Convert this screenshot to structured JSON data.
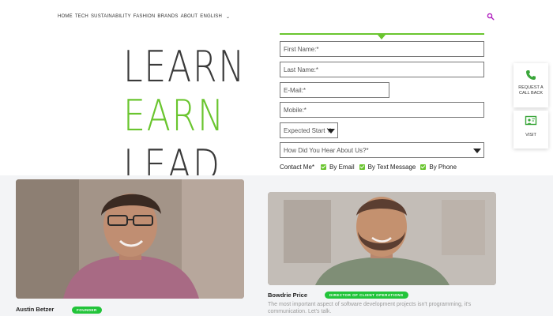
{
  "nav": {
    "items": [
      "HOME",
      "TECH",
      "SUSTAINABILITY",
      "FASHION",
      "BRANDS",
      "ABOUT",
      "ENGLISH"
    ],
    "search_icon": "search-icon",
    "accent": "#b01fbf"
  },
  "hero": {
    "line1": "LEARN",
    "line2": "EARN",
    "line3": "LEAD",
    "accent": "#6ac52f"
  },
  "form": {
    "first_name": "First Name:*",
    "last_name": "Last Name:*",
    "email": "E-Mail:*",
    "mobile": "Mobile:*",
    "expected_start": "Expected Start Y",
    "how_did_you_hear": "How Did You Hear About Us?*",
    "contact_label": "Contact Me*",
    "contact_options": [
      "By Email",
      "By Text Message",
      "By Phone"
    ]
  },
  "widgets": {
    "callback_label": "REQUEST A CALL BACK",
    "visit_label": "VISIT"
  },
  "team": {
    "members": [
      {
        "name": "Austin Betzer",
        "role": "FOUNDER"
      },
      {
        "name": "Bowdrie Price",
        "role": "DIRECTOR OF CLIENT OPERATIONS",
        "bio": "The most important aspect of software development projects isn't programming, it's communication. Let's talk."
      }
    ]
  }
}
